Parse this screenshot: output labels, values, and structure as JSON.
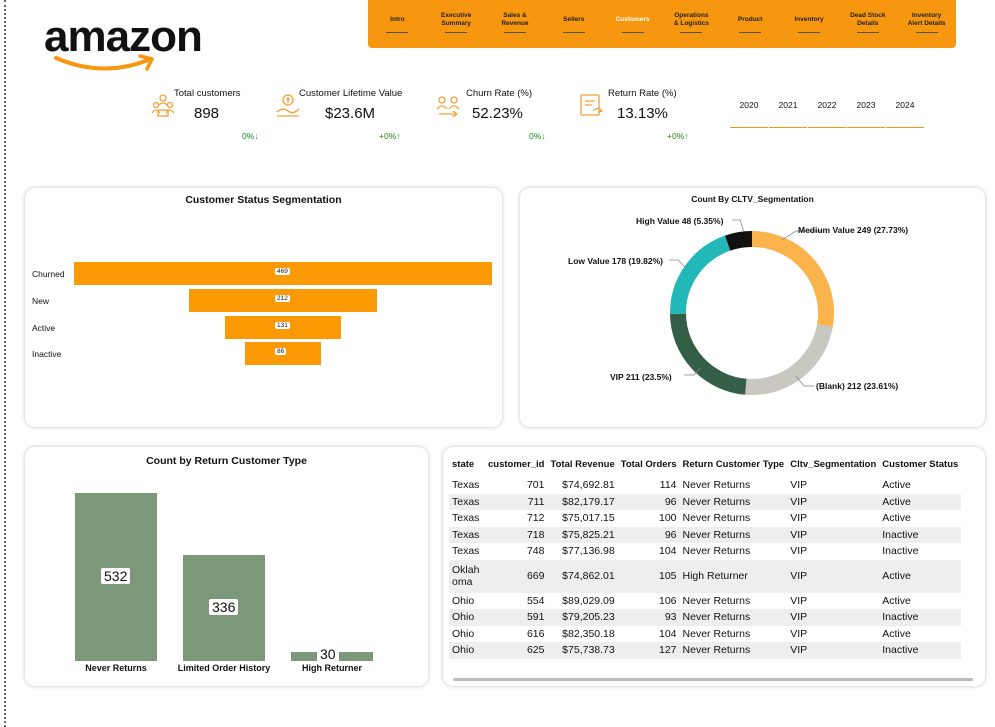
{
  "logo": {
    "text": "amazon",
    "icon": "amazon-smile-arrow",
    "accent": "#f7960f"
  },
  "nav": {
    "items": [
      {
        "label": "Intro"
      },
      {
        "label": "Executive\nSummary"
      },
      {
        "label": "Sales &\nRevenue"
      },
      {
        "label": "Sellers"
      },
      {
        "label": "Customers",
        "active": true
      },
      {
        "label": "Operations\n& Logistics"
      },
      {
        "label": "Product"
      },
      {
        "label": "Inventory"
      },
      {
        "label": "Dead Stock\nDetails"
      },
      {
        "label": "Inventory\nAlert Details"
      }
    ]
  },
  "kpis": [
    {
      "icon": "customers-icon",
      "title": "Total customers",
      "value": "898",
      "delta": "0%↓"
    },
    {
      "icon": "lifetime-value-icon",
      "title": "Customer Lifetime Value",
      "value": "$23.6M",
      "delta": "+0%↑"
    },
    {
      "icon": "churn-icon",
      "title": "Churn Rate (%)",
      "value": "52.23%",
      "delta": "0%↓"
    },
    {
      "icon": "return-icon",
      "title": "Return Rate (%)",
      "value": "13.13%",
      "delta": "+0%↑"
    }
  ],
  "years": [
    "2020",
    "2021",
    "2022",
    "2023",
    "2024"
  ],
  "funnel": {
    "title": "Customer Status Segmentation",
    "color": "#fb9a05",
    "chart_data": {
      "type": "bar",
      "categories": [
        "Churned",
        "New",
        "Active",
        "Inactive"
      ],
      "values": [
        469,
        212,
        131,
        86
      ]
    }
  },
  "donut": {
    "title": "Count By CLTV_Segmentation",
    "chart_data": {
      "type": "pie",
      "slices": [
        {
          "label": "Medium Value 249 (27.73%)",
          "value": 249,
          "color": "#fbb34c"
        },
        {
          "label": "(Blank) 212 (23.61%)",
          "value": 212,
          "color": "#c8c8c0"
        },
        {
          "label": "VIP 211 (23.5%)",
          "value": 211,
          "color": "#345e45"
        },
        {
          "label": "Low Value 178 (19.82%)",
          "value": 178,
          "color": "#22b8b8"
        },
        {
          "label": "High Value 48 (5.35%)",
          "value": 48,
          "color": "#111111"
        }
      ]
    }
  },
  "returns": {
    "title": "Count by Return Customer Type",
    "color": "#7d977b",
    "chart_data": {
      "type": "bar",
      "categories": [
        "Never Returns",
        "Limited Order History",
        "High Returner"
      ],
      "values": [
        532,
        336,
        30
      ]
    }
  },
  "table": {
    "columns": [
      "state",
      "customer_id",
      "Total Revenue",
      "Total Orders",
      "Return Customer Type",
      "Cltv_Segmentation",
      "Customer Status"
    ],
    "rows": [
      [
        "Texas",
        "701",
        "$74,692.81",
        "114",
        "Never Returns",
        "VIP",
        "Active"
      ],
      [
        "Texas",
        "711",
        "$82,179.17",
        "96",
        "Never Returns",
        "VIP",
        "Active"
      ],
      [
        "Texas",
        "712",
        "$75,017.15",
        "100",
        "Never Returns",
        "VIP",
        "Active"
      ],
      [
        "Texas",
        "718",
        "$75,825.21",
        "96",
        "Never Returns",
        "VIP",
        "Inactive"
      ],
      [
        "Texas",
        "748",
        "$77,136.98",
        "104",
        "Never Returns",
        "VIP",
        "Inactive"
      ],
      [
        "Oklah oma",
        "669",
        "$74,862.01",
        "105",
        "High Returner",
        "VIP",
        "Active"
      ],
      [
        "Ohio",
        "554",
        "$89,029.09",
        "106",
        "Never Returns",
        "VIP",
        "Active"
      ],
      [
        "Ohio",
        "591",
        "$79,205.23",
        "93",
        "Never Returns",
        "VIP",
        "Inactive"
      ],
      [
        "Ohio",
        "616",
        "$82,350.18",
        "104",
        "Never Returns",
        "VIP",
        "Active"
      ],
      [
        "Ohio",
        "625",
        "$75,738.73",
        "127",
        "Never Returns",
        "VIP",
        "Inactive"
      ]
    ]
  }
}
